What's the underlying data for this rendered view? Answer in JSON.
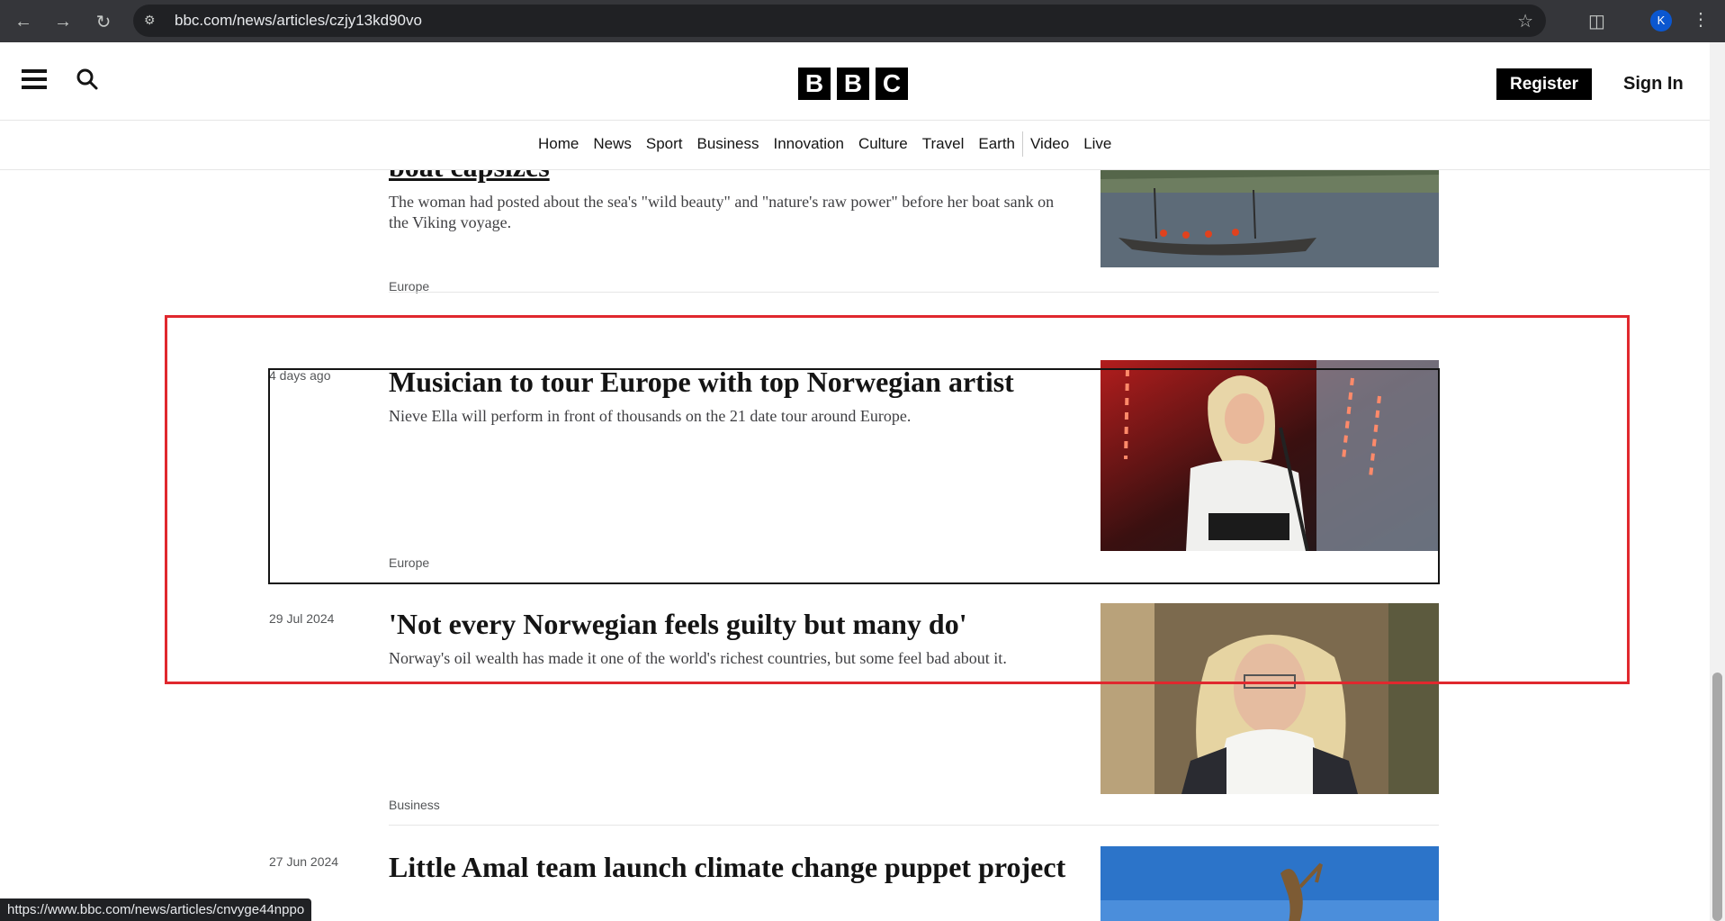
{
  "browser": {
    "url": "bbc.com/news/articles/czjy13kd90vo",
    "profile_initial": "K"
  },
  "header": {
    "logo_letters": [
      "B",
      "B",
      "C"
    ],
    "register_label": "Register",
    "signin_label": "Sign In"
  },
  "nav": {
    "items": [
      "Home",
      "News",
      "Sport",
      "Business",
      "Innovation",
      "Culture",
      "Travel",
      "Earth",
      "Video",
      "Live"
    ]
  },
  "articles": [
    {
      "headline": "boat capsizes",
      "summary": "The woman had posted about the sea's \"wild beauty\" and \"nature's raw power\" before her boat sank on the Viking voyage.",
      "tag": "Europe"
    },
    {
      "date": "4 days ago",
      "headline": "Musician to tour Europe with top Norwegian artist",
      "summary": "Nieve Ella will perform in front of thousands on the 21 date tour around Europe.",
      "tag": "Europe"
    },
    {
      "date": "29 Jul 2024",
      "headline": "'Not every Norwegian feels guilty but many do'",
      "summary": "Norway's oil wealth has made it one of the world's richest countries, but some feel bad about it.",
      "tag": "Business"
    },
    {
      "date": "27 Jun 2024",
      "headline": "Little Amal team launch climate change puppet project"
    }
  ],
  "status_bar": {
    "url": "https://www.bbc.com/news/articles/cnvyge44nppo"
  },
  "colors": {
    "annotation": "#e0282e",
    "chrome": "#35363a",
    "brand": "#000000"
  }
}
